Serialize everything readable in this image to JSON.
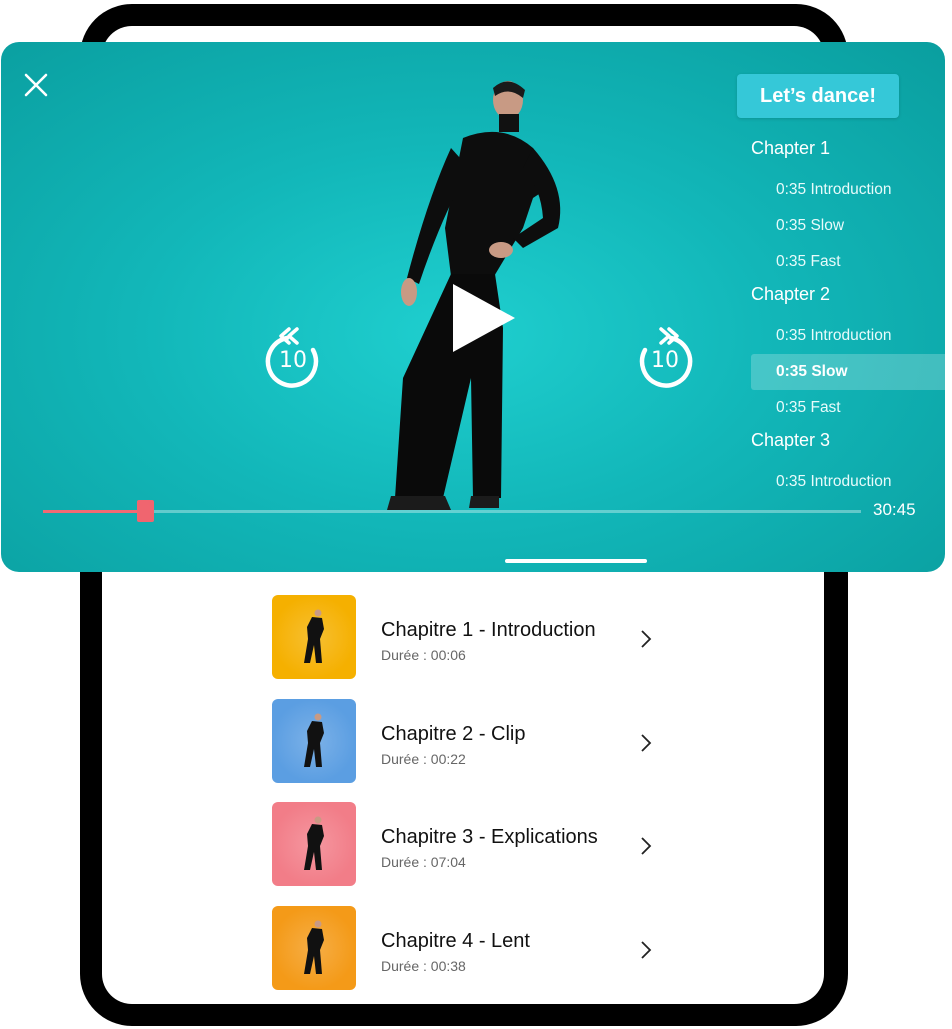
{
  "player": {
    "cta_label": "Let’s dance!",
    "skip_back_seconds": "10",
    "skip_forward_seconds": "10",
    "duration": "30:45",
    "progress_fraction": 0.125,
    "chapters": [
      {
        "title": "Chapter 1",
        "items": [
          {
            "label": "0:35 Introduction"
          },
          {
            "label": "0:35 Slow"
          },
          {
            "label": "0:35 Fast"
          }
        ]
      },
      {
        "title": "Chapter 2",
        "items": [
          {
            "label": "0:35 Introduction"
          },
          {
            "label": "0:35 Slow",
            "active": true
          },
          {
            "label": "0:35 Fast"
          }
        ]
      },
      {
        "title": "Chapter 3",
        "items": [
          {
            "label": "0:35 Introduction"
          }
        ]
      }
    ]
  },
  "list": [
    {
      "title": "Chapitre 1 - Introduction",
      "duration": "Durée : 00:06",
      "color": "#f5b000"
    },
    {
      "title": "Chapitre 2 - Clip",
      "duration": "Durée : 00:22",
      "color": "#5b9ee2"
    },
    {
      "title": "Chapitre 3 - Explications",
      "duration": "Durée : 07:04",
      "color": "#f27d88"
    },
    {
      "title": "Chapitre 4 - Lent",
      "duration": "Durée : 00:38",
      "color": "#f49a18"
    }
  ],
  "colors": {
    "player_bg": "#12b7b9",
    "accent": "#f06a74",
    "cta_bg": "#35c8d8"
  },
  "icons": [
    "close-icon",
    "replay-10-icon",
    "play-icon",
    "forward-10-icon",
    "chevron-right-icon"
  ]
}
